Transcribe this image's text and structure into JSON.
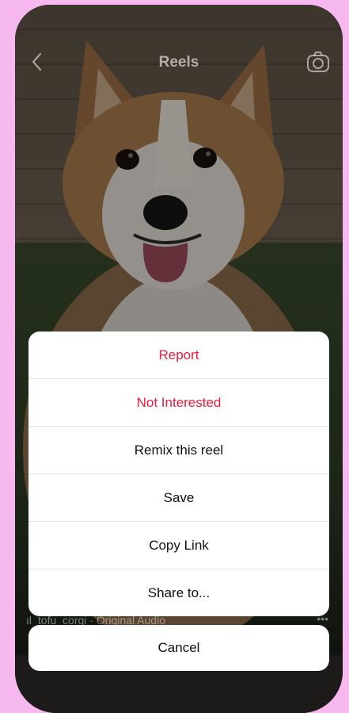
{
  "header": {
    "title": "Reels"
  },
  "audio": {
    "text": "tofu_corgi · Original Audio",
    "more_label": "•••"
  },
  "menu": {
    "items": [
      {
        "label": "Report"
      },
      {
        "label": "Not Interested"
      },
      {
        "label": "Remix this reel"
      },
      {
        "label": "Save"
      },
      {
        "label": "Copy Link"
      },
      {
        "label": "Share to..."
      }
    ],
    "cancel_label": "Cancel"
  },
  "colors": {
    "background": "#f7b8f0",
    "destructive": "#ed1c3a",
    "sheet": "#ffffff",
    "separator": "#e4e4e6"
  },
  "icons": {
    "back": "chevron-left-icon",
    "camera": "camera-icon",
    "audio": "audio-bars-icon",
    "more": "more-dots-icon"
  }
}
